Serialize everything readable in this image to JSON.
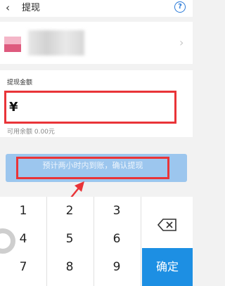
{
  "header": {
    "back_icon": "‹",
    "title": "提现",
    "help_icon": "?"
  },
  "bank": {
    "chevron": "›"
  },
  "amount": {
    "label": "提现金额",
    "currency": "¥",
    "available": "可用余额 0.00元"
  },
  "withdraw": {
    "label": "预计两小时内到账，确认提现"
  },
  "keypad": {
    "keys": [
      "1",
      "2",
      "3",
      "4",
      "5",
      "6",
      "7",
      "8",
      "9"
    ],
    "confirm": "确定"
  },
  "colors": {
    "accent": "#1d8fe3",
    "highlight": "#e93438",
    "button_disabled": "#9cc6ee"
  }
}
